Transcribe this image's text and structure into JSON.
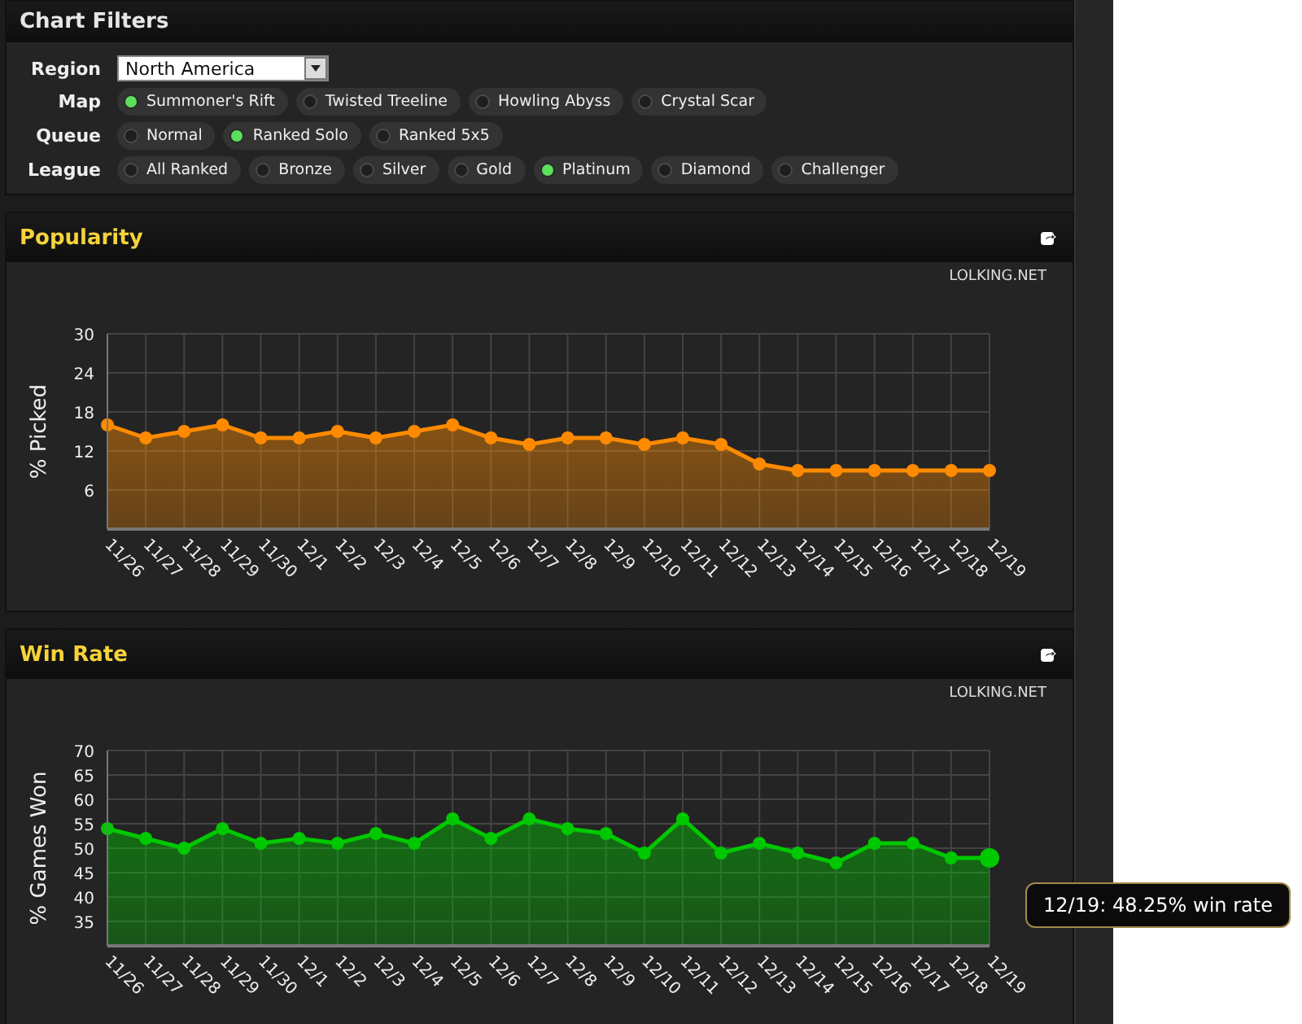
{
  "filters": {
    "title": "Chart Filters",
    "region": {
      "label": "Region",
      "value": "North America"
    },
    "groups": [
      {
        "label": "Map",
        "options": [
          {
            "label": "Summoner's Rift",
            "selected": true
          },
          {
            "label": "Twisted Treeline",
            "selected": false
          },
          {
            "label": "Howling Abyss",
            "selected": false
          },
          {
            "label": "Crystal Scar",
            "selected": false
          }
        ]
      },
      {
        "label": "Queue",
        "options": [
          {
            "label": "Normal",
            "selected": false
          },
          {
            "label": "Ranked Solo",
            "selected": true
          },
          {
            "label": "Ranked 5x5",
            "selected": false
          }
        ]
      },
      {
        "label": "League",
        "options": [
          {
            "label": "All Ranked",
            "selected": false
          },
          {
            "label": "Bronze",
            "selected": false
          },
          {
            "label": "Silver",
            "selected": false
          },
          {
            "label": "Gold",
            "selected": false
          },
          {
            "label": "Platinum",
            "selected": true
          },
          {
            "label": "Diamond",
            "selected": false
          },
          {
            "label": "Challenger",
            "selected": false
          }
        ]
      }
    ]
  },
  "panels": [
    {
      "title": "Popularity",
      "source": "LOLKING.NET",
      "chart_data": {
        "type": "area",
        "grid": true,
        "categories": [
          "11/26",
          "11/27",
          "11/28",
          "11/29",
          "11/30",
          "12/1",
          "12/2",
          "12/3",
          "12/4",
          "12/5",
          "12/6",
          "12/7",
          "12/8",
          "12/9",
          "12/10",
          "12/11",
          "12/12",
          "12/13",
          "12/14",
          "12/15",
          "12/16",
          "12/17",
          "12/18",
          "12/19"
        ],
        "ylim": [
          0,
          30
        ],
        "yticks": [
          6,
          12,
          18,
          24,
          30
        ],
        "series": [
          {
            "name": "% Picked",
            "color": "#ff8a00",
            "values": [
              16,
              14,
              15,
              16,
              14,
              14,
              15,
              14,
              15,
              16,
              14,
              13,
              14,
              14,
              13,
              14,
              13,
              10,
              9,
              9,
              9,
              9,
              9,
              9
            ]
          }
        ]
      }
    },
    {
      "title": "Win Rate",
      "source": "LOLKING.NET",
      "tooltip": "12/19: 48.25% win rate",
      "chart_data": {
        "type": "area",
        "grid": true,
        "categories": [
          "11/26",
          "11/27",
          "11/28",
          "11/29",
          "11/30",
          "12/1",
          "12/2",
          "12/3",
          "12/4",
          "12/5",
          "12/6",
          "12/7",
          "12/8",
          "12/9",
          "12/10",
          "12/11",
          "12/12",
          "12/13",
          "12/14",
          "12/15",
          "12/16",
          "12/17",
          "12/18",
          "12/19"
        ],
        "ylim": [
          30,
          70
        ],
        "yticks": [
          35,
          40,
          45,
          50,
          55,
          60,
          65,
          70
        ],
        "series": [
          {
            "name": "% Games Won",
            "color": "#00c800",
            "values": [
              54,
              52,
              50,
              54,
              51,
              52,
              51,
              53,
              51,
              56,
              52,
              56,
              54,
              53,
              49,
              56,
              49,
              51,
              49,
              47,
              51,
              51,
              48,
              48
            ]
          }
        ]
      }
    }
  ]
}
